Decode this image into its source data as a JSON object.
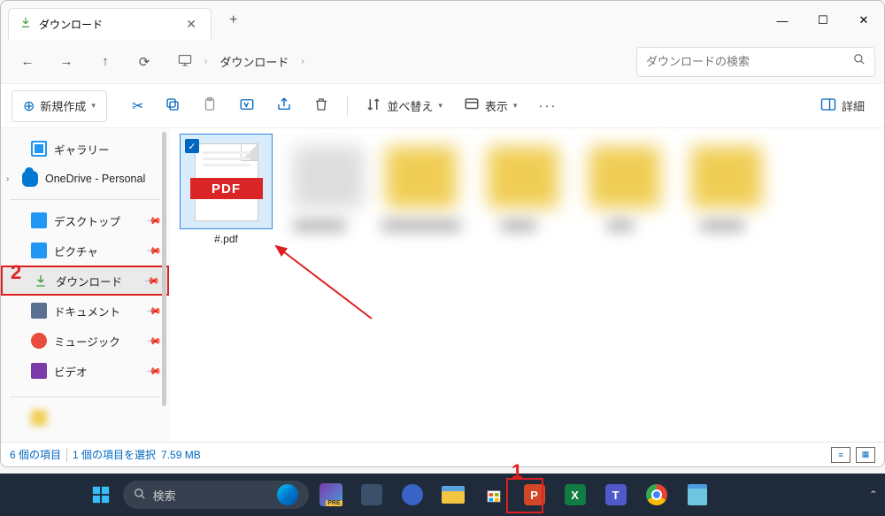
{
  "window": {
    "tab_title": "ダウンロード",
    "new_tab": "+",
    "close": "✕",
    "minimize": "—",
    "maximize": "☐"
  },
  "nav": {
    "back": "←",
    "forward": "→",
    "up": "↑",
    "refresh": "⟳",
    "path_segments": [
      "ダウンロード"
    ],
    "search_placeholder": "ダウンロードの検索"
  },
  "toolbar": {
    "new": "新規作成",
    "sort": "並べ替え",
    "view": "表示",
    "details": "詳細",
    "icons": {
      "cut": "✂",
      "copy": "⧉",
      "paste": "📋",
      "rename": "A̲",
      "share": "↗",
      "delete": "🗑",
      "more": "···"
    }
  },
  "sidebar": {
    "items": [
      {
        "label": "ギャラリー",
        "icon": "gallery",
        "pin": false
      },
      {
        "label": "OneDrive - Personal",
        "icon": "cloud",
        "expand": true,
        "pin": false
      },
      {
        "label": "デスクトップ",
        "icon": "desktop",
        "pin": true
      },
      {
        "label": "ピクチャ",
        "icon": "pictures",
        "pin": true
      },
      {
        "label": "ダウンロード",
        "icon": "download",
        "pin": true,
        "highlighted": true
      },
      {
        "label": "ドキュメント",
        "icon": "documents",
        "pin": true
      },
      {
        "label": "ミュージック",
        "icon": "music",
        "pin": true
      },
      {
        "label": "ビデオ",
        "icon": "video",
        "pin": true
      }
    ]
  },
  "content": {
    "selected_file": {
      "name": "#.pdf",
      "badge": "PDF",
      "checked": true
    }
  },
  "statusbar": {
    "count": "6 個の項目",
    "selection": "1 個の項目を選択",
    "size": "7.59 MB"
  },
  "taskbar": {
    "search_placeholder": "検索"
  },
  "annotations": {
    "n1": "1",
    "n2": "2"
  }
}
